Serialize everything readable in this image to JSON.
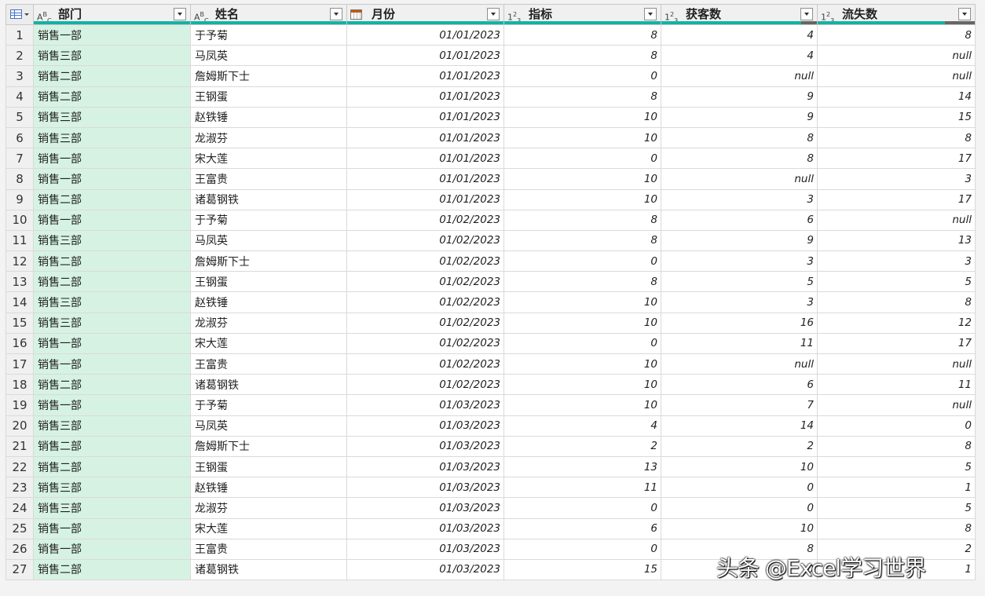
{
  "table": {
    "columns": [
      {
        "title": "部门",
        "type_icon": "text-type-icon"
      },
      {
        "title": "姓名",
        "type_icon": "text-type-icon"
      },
      {
        "title": "月份",
        "type_icon": "date-type-icon"
      },
      {
        "title": "指标",
        "type_icon": "number-type-icon"
      },
      {
        "title": "获客数",
        "type_icon": "number-type-icon"
      },
      {
        "title": "流失数",
        "type_icon": "number-type-icon"
      }
    ],
    "type_labels": {
      "text": "ABC",
      "number": "123"
    },
    "rows": [
      [
        "1",
        "销售一部",
        "于予菊",
        "01/01/2023",
        "8",
        "4",
        "8"
      ],
      [
        "2",
        "销售三部",
        "马凤英",
        "01/01/2023",
        "8",
        "4",
        "null"
      ],
      [
        "3",
        "销售二部",
        "詹姆斯下士",
        "01/01/2023",
        "0",
        "null",
        "null"
      ],
      [
        "4",
        "销售二部",
        "王钢蛋",
        "01/01/2023",
        "8",
        "9",
        "14"
      ],
      [
        "5",
        "销售三部",
        "赵铁锤",
        "01/01/2023",
        "10",
        "9",
        "15"
      ],
      [
        "6",
        "销售三部",
        "龙淑芬",
        "01/01/2023",
        "10",
        "8",
        "8"
      ],
      [
        "7",
        "销售一部",
        "宋大莲",
        "01/01/2023",
        "0",
        "8",
        "17"
      ],
      [
        "8",
        "销售一部",
        "王富贵",
        "01/01/2023",
        "10",
        "null",
        "3"
      ],
      [
        "9",
        "销售二部",
        "诸葛钢铁",
        "01/01/2023",
        "10",
        "3",
        "17"
      ],
      [
        "10",
        "销售一部",
        "于予菊",
        "01/02/2023",
        "8",
        "6",
        "null"
      ],
      [
        "11",
        "销售三部",
        "马凤英",
        "01/02/2023",
        "8",
        "9",
        "13"
      ],
      [
        "12",
        "销售二部",
        "詹姆斯下士",
        "01/02/2023",
        "0",
        "3",
        "3"
      ],
      [
        "13",
        "销售二部",
        "王钢蛋",
        "01/02/2023",
        "8",
        "5",
        "5"
      ],
      [
        "14",
        "销售三部",
        "赵铁锤",
        "01/02/2023",
        "10",
        "3",
        "8"
      ],
      [
        "15",
        "销售三部",
        "龙淑芬",
        "01/02/2023",
        "10",
        "16",
        "12"
      ],
      [
        "16",
        "销售一部",
        "宋大莲",
        "01/02/2023",
        "0",
        "11",
        "17"
      ],
      [
        "17",
        "销售一部",
        "王富贵",
        "01/02/2023",
        "10",
        "null",
        "null"
      ],
      [
        "18",
        "销售二部",
        "诸葛钢铁",
        "01/02/2023",
        "10",
        "6",
        "11"
      ],
      [
        "19",
        "销售一部",
        "于予菊",
        "01/03/2023",
        "10",
        "7",
        "null"
      ],
      [
        "20",
        "销售三部",
        "马凤英",
        "01/03/2023",
        "4",
        "14",
        "0"
      ],
      [
        "21",
        "销售二部",
        "詹姆斯下士",
        "01/03/2023",
        "2",
        "2",
        "8"
      ],
      [
        "22",
        "销售二部",
        "王钢蛋",
        "01/03/2023",
        "13",
        "10",
        "5"
      ],
      [
        "23",
        "销售三部",
        "赵铁锤",
        "01/03/2023",
        "11",
        "0",
        "1"
      ],
      [
        "24",
        "销售三部",
        "龙淑芬",
        "01/03/2023",
        "0",
        "0",
        "5"
      ],
      [
        "25",
        "销售一部",
        "宋大莲",
        "01/03/2023",
        "6",
        "10",
        "8"
      ],
      [
        "26",
        "销售一部",
        "王富贵",
        "01/03/2023",
        "0",
        "8",
        "2"
      ],
      [
        "27",
        "销售二部",
        "诸葛钢铁",
        "01/03/2023",
        "15",
        "0",
        "1"
      ]
    ]
  },
  "watermark": "头条 @Excel学习世界",
  "colors": {
    "header_bar": "#13b2a4",
    "selected_column": "#d6f2e3",
    "error_bar": "#666666"
  }
}
